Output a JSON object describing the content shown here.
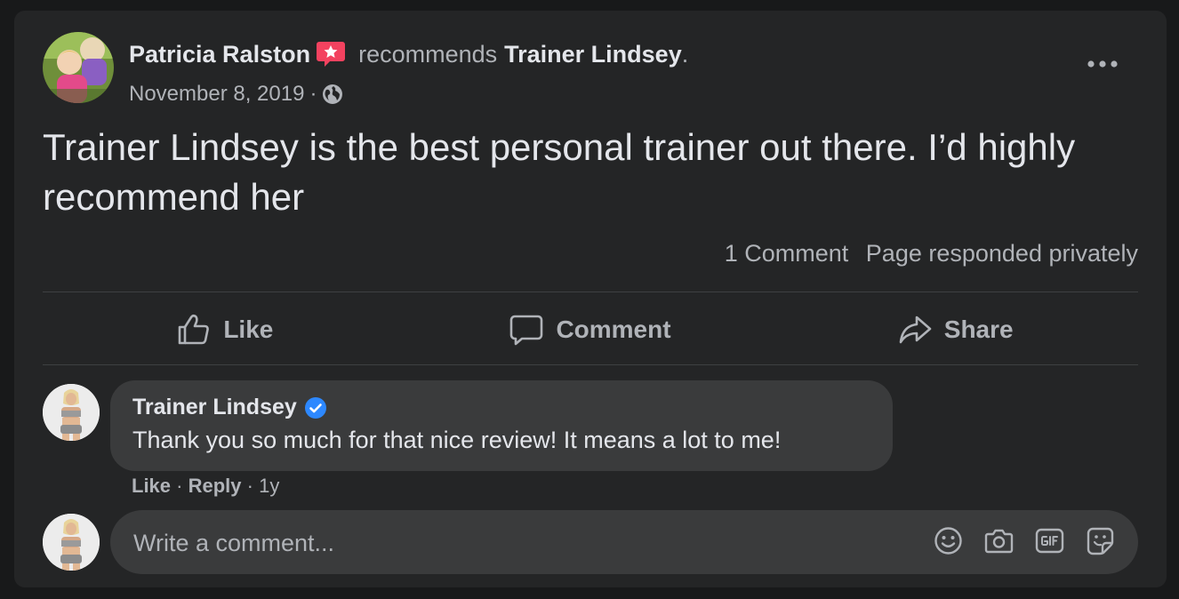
{
  "post": {
    "author": "Patricia Ralston",
    "action_text": "recommends",
    "page_name": "Trainer Lindsey",
    "page_suffix": ".",
    "date": "November 8, 2019",
    "separator": "·",
    "privacy_icon": "globe-icon",
    "body": "Trainer Lindsey is the best personal trainer out there. I’d highly recommend her",
    "comment_count": "1 Comment",
    "response_note": "Page responded privately"
  },
  "actions": {
    "like_label": "Like",
    "comment_label": "Comment",
    "share_label": "Share"
  },
  "comment": {
    "author": "Trainer Lindsey",
    "text": "Thank you so much for that nice review! It means a lot to me!",
    "like_label": "Like",
    "reply_label": "Reply",
    "age": "1y",
    "separator": "·"
  },
  "composer": {
    "placeholder": "Write a comment...",
    "icons": [
      "emoji-icon",
      "camera-icon",
      "gif-icon",
      "sticker-icon"
    ]
  },
  "colors": {
    "background": "#18191a",
    "card": "#242526",
    "bubble": "#3a3b3c",
    "primary_text": "#e4e6eb",
    "secondary_text": "#b0b3b8",
    "recommend_red": "#f3425f",
    "verified_blue": "#2d88ff"
  }
}
